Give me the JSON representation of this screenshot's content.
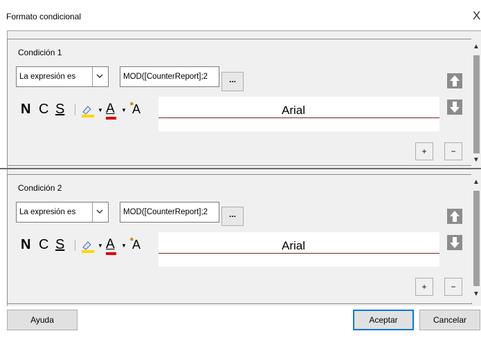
{
  "window": {
    "title": "Formato condicional",
    "close_glyph": "X"
  },
  "conditions": [
    {
      "label": "Condición 1",
      "type": "La expresión es",
      "expression": "MOD([CounterReport];2",
      "browse_label": "...",
      "format": {
        "bold": "N",
        "italic": "C",
        "underline": "S",
        "font_glyph": "A",
        "size_glyph": "A"
      },
      "preview_font": "Arial",
      "add_label": "+",
      "remove_label": "−"
    },
    {
      "label": "Condición 2",
      "type": "La expresión es",
      "expression": "MOD([CounterReport];2",
      "browse_label": "...",
      "format": {
        "bold": "N",
        "italic": "C",
        "underline": "S",
        "font_glyph": "A",
        "size_glyph": "A"
      },
      "preview_font": "Arial",
      "add_label": "+",
      "remove_label": "−"
    }
  ],
  "footer": {
    "help_label": "Ayuda",
    "ok_label": "Aceptar",
    "cancel_label": "Cancelar"
  },
  "colors": {
    "highlight": "#ffd400",
    "font_color": "#e00000",
    "primary_border": "#0078d7",
    "preview_line": "#7a1f1f"
  },
  "icons": [
    "close-icon",
    "dropdown-arrow-icon",
    "highlight-color-icon",
    "font-color-icon",
    "font-size-icon",
    "move-up-icon",
    "move-down-icon",
    "scroll-up-icon",
    "scroll-down-icon"
  ]
}
